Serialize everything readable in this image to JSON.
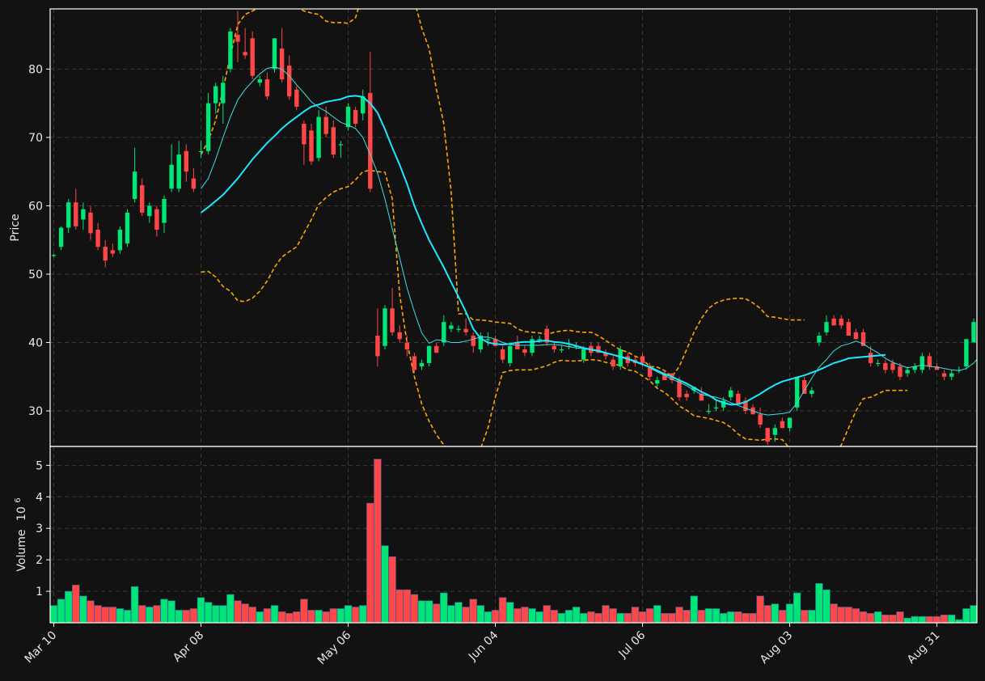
{
  "chart_data": {
    "type": "candlestick",
    "colors": {
      "background": "#121212",
      "frame": "#ffffff",
      "grid": "#3a3a3a",
      "up": "#00e676",
      "down": "#ff4747",
      "ma_fast": "#40e0e0",
      "ma_slow": "#1ee8ff",
      "bands": "#ffa500",
      "text": "#e8e8e8"
    },
    "x_ticks": [
      "Mar 10",
      "Apr 08",
      "May 06",
      "Jun 04",
      "Jul 06",
      "Aug 03",
      "Aug 31"
    ],
    "x_tick_index": [
      0,
      20,
      40,
      60,
      80,
      100,
      120
    ],
    "price_panel": {
      "ylabel": "Price",
      "ylim": [
        24.8,
        88.8
      ],
      "yticks": [
        30,
        40,
        50,
        60,
        70,
        80
      ],
      "grid": true
    },
    "volume_panel": {
      "ylabel": "Volume",
      "ylabel_exponent": "10",
      "ylabel_exponent_power": "6",
      "ylim": [
        0,
        5.6
      ],
      "yticks": [
        1,
        2,
        3,
        4,
        5
      ],
      "grid": true
    },
    "candles": [
      [
        52.7,
        53.0,
        52.5,
        52.8
      ],
      [
        54.0,
        57.0,
        53.5,
        56.8
      ],
      [
        56.8,
        61.0,
        56.0,
        60.5
      ],
      [
        60.5,
        62.5,
        56.5,
        57.0
      ],
      [
        58.0,
        60.5,
        56.5,
        59.5
      ],
      [
        59.0,
        60.0,
        55.0,
        56.0
      ],
      [
        56.5,
        57.5,
        53.5,
        54.0
      ],
      [
        54.0,
        55.0,
        51.0,
        52.0
      ],
      [
        53.5,
        54.5,
        52.5,
        53.0
      ],
      [
        53.5,
        57.0,
        53.0,
        56.5
      ],
      [
        54.5,
        59.5,
        54.0,
        59.0
      ],
      [
        61.0,
        68.5,
        60.5,
        65.0
      ],
      [
        63.0,
        64.0,
        58.5,
        59.0
      ],
      [
        58.5,
        60.5,
        57.5,
        60.0
      ],
      [
        59.5,
        60.0,
        55.5,
        56.5
      ],
      [
        57.5,
        61.5,
        56.0,
        61.0
      ],
      [
        62.5,
        69.0,
        62.0,
        66.0
      ],
      [
        62.5,
        69.5,
        62.0,
        67.5
      ],
      [
        68.0,
        69.0,
        63.5,
        65.0
      ],
      [
        64.0,
        65.5,
        62.0,
        62.5
      ],
      [
        68.0,
        69.5,
        67.0,
        68.0
      ],
      [
        68.0,
        76.5,
        67.5,
        75.0
      ],
      [
        75.0,
        78.0,
        73.5,
        77.5
      ],
      [
        75.0,
        79.0,
        72.0,
        78.0
      ],
      [
        80.0,
        86.0,
        79.5,
        85.5
      ],
      [
        85.0,
        88.5,
        81.0,
        84.0
      ],
      [
        82.5,
        86.0,
        81.5,
        82.0
      ],
      [
        84.5,
        85.5,
        78.5,
        79.0
      ],
      [
        78.0,
        79.0,
        77.5,
        78.5
      ],
      [
        78.5,
        79.5,
        75.5,
        76.0
      ],
      [
        80.0,
        84.5,
        79.5,
        84.5
      ],
      [
        83.0,
        86.0,
        78.0,
        78.5
      ],
      [
        80.5,
        82.0,
        75.5,
        76.0
      ],
      [
        77.0,
        77.5,
        74.0,
        74.5
      ],
      [
        72.0,
        72.5,
        66.0,
        69.0
      ],
      [
        71.0,
        72.0,
        66.0,
        66.5
      ],
      [
        67.0,
        74.0,
        66.5,
        73.0
      ],
      [
        73.0,
        74.5,
        70.0,
        70.5
      ],
      [
        71.5,
        72.5,
        67.0,
        67.5
      ],
      [
        69.0,
        69.5,
        67.0,
        69.0
      ],
      [
        71.5,
        75.0,
        71.0,
        74.5
      ],
      [
        74.0,
        74.5,
        71.5,
        72.0
      ],
      [
        73.5,
        77.0,
        72.5,
        76.0
      ],
      [
        76.5,
        82.5,
        62.0,
        62.5
      ],
      [
        41.0,
        45.0,
        36.5,
        38.0
      ],
      [
        39.5,
        45.5,
        39.0,
        45.0
      ],
      [
        45.0,
        48.0,
        41.0,
        41.5
      ],
      [
        41.5,
        42.5,
        40.0,
        40.5
      ],
      [
        40.0,
        41.0,
        38.0,
        39.0
      ],
      [
        38.0,
        38.5,
        35.5,
        36.0
      ],
      [
        36.5,
        37.5,
        36.0,
        37.0
      ],
      [
        37.0,
        39.5,
        36.5,
        39.5
      ],
      [
        39.5,
        40.0,
        38.5,
        38.5
      ],
      [
        40.0,
        44.0,
        39.5,
        43.0
      ],
      [
        42.0,
        43.0,
        41.5,
        42.5
      ],
      [
        42.0,
        42.5,
        41.5,
        42.0
      ],
      [
        42.0,
        43.5,
        41.0,
        41.5
      ],
      [
        41.0,
        41.5,
        38.5,
        39.5
      ],
      [
        39.0,
        41.5,
        38.5,
        41.0
      ],
      [
        40.5,
        41.5,
        39.5,
        40.5
      ],
      [
        40.5,
        41.0,
        39.5,
        39.5
      ],
      [
        39.0,
        39.5,
        37.0,
        37.5
      ],
      [
        37.0,
        40.0,
        36.5,
        39.5
      ],
      [
        40.0,
        41.0,
        39.5,
        39.0
      ],
      [
        39.0,
        39.5,
        38.0,
        38.5
      ],
      [
        38.5,
        41.0,
        38.0,
        40.5
      ],
      [
        40.5,
        41.0,
        40.0,
        40.5
      ],
      [
        42.0,
        42.5,
        39.5,
        40.0
      ],
      [
        39.5,
        40.0,
        38.5,
        39.0
      ],
      [
        39.0,
        39.5,
        38.5,
        39.0
      ],
      [
        39.5,
        40.5,
        39.0,
        39.5
      ],
      [
        39.5,
        40.0,
        39.0,
        39.5
      ],
      [
        37.5,
        39.5,
        37.0,
        39.0
      ],
      [
        39.5,
        40.0,
        38.0,
        38.5
      ],
      [
        39.5,
        40.0,
        38.5,
        38.5
      ],
      [
        38.5,
        39.0,
        37.5,
        38.0
      ],
      [
        37.5,
        38.0,
        36.0,
        36.5
      ],
      [
        36.5,
        39.5,
        36.0,
        39.0
      ],
      [
        38.0,
        38.5,
        36.5,
        37.0
      ],
      [
        37.5,
        38.0,
        36.5,
        37.0
      ],
      [
        38.0,
        38.5,
        36.5,
        37.0
      ],
      [
        36.5,
        37.0,
        34.5,
        35.0
      ],
      [
        34.0,
        35.0,
        33.5,
        34.5
      ],
      [
        35.5,
        36.0,
        34.5,
        34.5
      ],
      [
        35.5,
        35.5,
        34.0,
        34.5
      ],
      [
        34.5,
        35.0,
        31.5,
        32.0
      ],
      [
        32.5,
        33.0,
        31.5,
        32.0
      ],
      [
        33.0,
        33.5,
        32.5,
        33.5
      ],
      [
        32.5,
        33.5,
        31.5,
        31.5
      ],
      [
        30.0,
        31.0,
        29.5,
        30.0
      ],
      [
        30.5,
        31.5,
        30.0,
        30.5
      ],
      [
        30.5,
        32.0,
        30.0,
        31.5
      ],
      [
        32.0,
        33.5,
        31.5,
        33.0
      ],
      [
        32.5,
        33.0,
        31.0,
        31.0
      ],
      [
        31.5,
        32.0,
        29.5,
        30.0
      ],
      [
        30.5,
        31.0,
        29.5,
        29.5
      ],
      [
        29.5,
        30.5,
        27.5,
        28.0
      ],
      [
        27.5,
        27.5,
        25.0,
        25.5
      ],
      [
        26.5,
        28.0,
        25.5,
        27.5
      ],
      [
        28.5,
        29.0,
        27.5,
        27.5
      ],
      [
        27.5,
        29.0,
        27.0,
        29.0
      ],
      [
        30.5,
        35.0,
        30.0,
        35.0
      ],
      [
        34.5,
        35.0,
        32.5,
        32.5
      ],
      [
        32.5,
        33.5,
        32.0,
        33.0
      ],
      [
        40.0,
        41.5,
        39.5,
        41.0
      ],
      [
        41.5,
        44.0,
        41.0,
        43.0
      ],
      [
        43.5,
        44.0,
        42.5,
        42.5
      ],
      [
        43.5,
        44.0,
        42.0,
        42.5
      ],
      [
        43.0,
        43.5,
        41.0,
        41.0
      ],
      [
        41.5,
        42.0,
        40.5,
        40.5
      ],
      [
        41.5,
        42.0,
        39.5,
        39.5
      ],
      [
        38.5,
        39.5,
        36.5,
        37.0
      ],
      [
        37.0,
        37.5,
        36.5,
        37.0
      ],
      [
        37.0,
        37.5,
        35.5,
        36.0
      ],
      [
        37.0,
        37.5,
        35.5,
        36.0
      ],
      [
        36.5,
        37.0,
        34.5,
        35.0
      ],
      [
        35.5,
        36.5,
        35.0,
        36.0
      ],
      [
        36.0,
        37.0,
        35.5,
        36.5
      ],
      [
        36.0,
        38.5,
        35.5,
        38.0
      ],
      [
        38.0,
        38.5,
        36.0,
        36.5
      ],
      [
        36.5,
        37.0,
        36.0,
        36.0
      ],
      [
        35.5,
        36.0,
        34.5,
        35.0
      ],
      [
        35.0,
        36.0,
        34.5,
        35.5
      ],
      [
        36.0,
        36.5,
        35.5,
        36.0
      ],
      [
        36.5,
        40.5,
        36.0,
        40.5
      ],
      [
        40.0,
        43.5,
        40.0,
        43.0
      ],
      [
        43.0,
        43.5,
        41.5,
        42.0
      ]
    ],
    "volume": [
      0.55,
      0.75,
      1.0,
      1.2,
      0.85,
      0.7,
      0.55,
      0.5,
      0.5,
      0.45,
      0.4,
      1.15,
      0.55,
      0.5,
      0.55,
      0.75,
      0.7,
      0.4,
      0.4,
      0.45,
      0.8,
      0.65,
      0.55,
      0.55,
      0.9,
      0.7,
      0.6,
      0.5,
      0.35,
      0.45,
      0.55,
      0.35,
      0.3,
      0.35,
      0.75,
      0.4,
      0.4,
      0.35,
      0.45,
      0.45,
      0.55,
      0.5,
      0.55,
      3.8,
      5.2,
      2.45,
      2.1,
      1.05,
      1.05,
      0.9,
      0.7,
      0.7,
      0.6,
      0.95,
      0.55,
      0.65,
      0.5,
      0.75,
      0.55,
      0.35,
      0.4,
      0.8,
      0.65,
      0.45,
      0.5,
      0.45,
      0.35,
      0.55,
      0.4,
      0.3,
      0.4,
      0.5,
      0.3,
      0.35,
      0.3,
      0.55,
      0.45,
      0.3,
      0.3,
      0.5,
      0.35,
      0.45,
      0.55,
      0.3,
      0.3,
      0.5,
      0.4,
      0.85,
      0.4,
      0.45,
      0.45,
      0.3,
      0.35,
      0.35,
      0.3,
      0.3,
      0.85,
      0.55,
      0.6,
      0.4,
      0.6,
      0.95,
      0.4,
      0.4,
      1.25,
      1.05,
      0.6,
      0.5,
      0.5,
      0.45,
      0.35,
      0.3,
      0.35,
      0.25,
      0.25,
      0.35,
      0.15,
      0.2,
      0.2,
      0.2,
      0.2,
      0.25,
      0.25,
      0.1,
      0.45,
      0.55,
      0.4
    ],
    "ma_fast": [
      null,
      null,
      null,
      null,
      null,
      null,
      null,
      null,
      null,
      null,
      null,
      null,
      null,
      null,
      null,
      null,
      null,
      null,
      null,
      null,
      62.5,
      64.0,
      66.8,
      70.0,
      73.0,
      75.5,
      77.0,
      78.2,
      79.3,
      80.1,
      80.3,
      80.0,
      79.0,
      77.7,
      76.5,
      75.2,
      74.4,
      73.8,
      73.0,
      72.2,
      71.8,
      71.3,
      70.0,
      67.5,
      64.8,
      61.0,
      56.6,
      52.4,
      48.0,
      44.5,
      41.4,
      39.9,
      40.4,
      40.3,
      40.0,
      40.0,
      40.2,
      40.5,
      40.8,
      40.8,
      40.5,
      40.0,
      39.7,
      39.6,
      39.6,
      39.6,
      39.6,
      39.7,
      39.7,
      39.6,
      39.4,
      39.2,
      39.1,
      38.9,
      38.7,
      38.4,
      38.2,
      38.0,
      37.7,
      37.3,
      36.9,
      36.3,
      35.7,
      35.2,
      34.6,
      34.2,
      33.7,
      33.0,
      32.4,
      32.2,
      32.0,
      31.7,
      31.2,
      30.8,
      30.4,
      30.0,
      29.6,
      29.4,
      29.5,
      29.6,
      29.8,
      31.2,
      33.0,
      34.8,
      36.4,
      37.5,
      38.8,
      39.5,
      39.8,
      40.2,
      39.8,
      39.1,
      38.5,
      37.7,
      37.1,
      36.7,
      36.3,
      36.5,
      36.7,
      36.5,
      36.4,
      36.2,
      36.0,
      35.9,
      36.2,
      37.0,
      38.2
    ],
    "ma_slow": [
      null,
      null,
      null,
      null,
      null,
      null,
      null,
      null,
      null,
      null,
      null,
      null,
      null,
      null,
      null,
      null,
      null,
      null,
      null,
      null,
      59.0,
      59.8,
      60.7,
      61.6,
      62.8,
      64.0,
      65.4,
      66.8,
      68.0,
      69.2,
      70.2,
      71.3,
      72.2,
      73.0,
      73.8,
      74.5,
      74.8,
      75.2,
      75.4,
      75.6,
      76.0,
      76.1,
      75.9,
      75.0,
      73.6,
      71.2,
      68.5,
      66.0,
      63.2,
      60.0,
      57.4,
      55.0,
      53.0,
      51.0,
      48.8,
      46.7,
      44.5,
      42.0,
      40.6,
      40.0,
      39.8,
      39.7,
      39.8,
      40.0,
      40.1,
      40.1,
      40.2,
      40.3,
      40.1,
      40.0,
      39.8,
      39.5,
      39.2,
      39.0,
      38.8,
      38.5,
      38.2,
      37.9,
      37.6,
      37.2,
      36.8,
      36.4,
      35.9,
      35.4,
      35.0,
      34.5,
      34.0,
      33.4,
      32.8,
      32.3,
      31.6,
      31.2,
      30.9,
      31.0,
      31.3,
      31.9,
      32.5,
      33.2,
      33.8,
      34.3,
      34.6,
      34.9,
      35.2,
      35.6,
      36.0,
      36.5,
      37.0,
      37.3,
      37.7,
      37.8,
      37.9,
      38.0,
      38.1,
      38.2
    ],
    "band_upper": [
      null,
      null,
      null,
      null,
      null,
      null,
      null,
      null,
      null,
      null,
      null,
      null,
      null,
      null,
      null,
      null,
      null,
      null,
      null,
      null,
      67.5,
      69.5,
      72.5,
      77.0,
      82.0,
      86.5,
      88.0,
      88.5,
      89.0,
      89.0,
      89.0,
      89.0,
      89.0,
      89.0,
      88.5,
      88.2,
      88.0,
      87.0,
      86.8,
      86.8,
      86.7,
      87.5,
      91.0,
      93.0,
      95.0,
      95.0,
      95.0,
      95.0,
      93.0,
      90.0,
      86.0,
      83.0,
      77.0,
      72.0,
      62.0,
      44.2,
      44.2,
      43.3,
      43.3,
      43.2,
      43.0,
      42.9,
      42.8,
      42.0,
      41.6,
      41.5,
      41.4,
      41.2,
      41.5,
      41.7,
      41.8,
      41.6,
      41.5,
      41.5,
      41.0,
      40.3,
      39.6,
      38.9,
      38.6,
      38.0,
      37.5,
      36.5,
      36.4,
      35.9,
      35.0,
      36.5,
      39.0,
      41.5,
      43.5,
      45.0,
      45.8,
      46.2,
      46.4,
      46.5,
      46.4,
      45.8,
      45.0,
      43.8,
      43.7,
      43.5,
      43.3,
      43.3,
      43.3
    ],
    "band_lower": [
      null,
      null,
      null,
      null,
      null,
      null,
      null,
      null,
      null,
      null,
      null,
      null,
      null,
      null,
      null,
      null,
      null,
      null,
      null,
      null,
      50.3,
      50.4,
      49.6,
      48.2,
      47.5,
      46.1,
      46.0,
      46.5,
      47.5,
      49.0,
      51.0,
      52.5,
      53.3,
      54.0,
      56.0,
      58.0,
      60.2,
      61.2,
      62.0,
      62.5,
      62.8,
      63.8,
      65.0,
      65.2,
      65.0,
      64.9,
      61.0,
      47.0,
      40.0,
      35.0,
      31.0,
      28.5,
      26.5,
      25.0,
      24.0,
      23.0,
      23.0,
      23.5,
      24.5,
      27.5,
      32.0,
      35.6,
      35.9,
      36.0,
      36.0,
      36.0,
      36.3,
      36.6,
      37.1,
      37.4,
      37.3,
      37.3,
      37.4,
      37.5,
      37.4,
      37.1,
      36.9,
      36.6,
      36.0,
      35.8,
      35.1,
      34.4,
      33.3,
      32.7,
      31.8,
      30.7,
      30.1,
      29.3,
      29.1,
      28.9,
      28.6,
      28.3,
      27.6,
      26.6,
      25.9,
      25.8,
      25.7,
      25.9,
      25.9,
      25.8,
      24.5,
      23.5,
      22.5,
      22.0,
      22.0,
      22.5,
      23.5,
      25.0,
      27.5,
      30.0,
      31.8,
      32.0,
      32.5,
      33.0,
      33.0,
      33.0,
      33.0
    ]
  }
}
